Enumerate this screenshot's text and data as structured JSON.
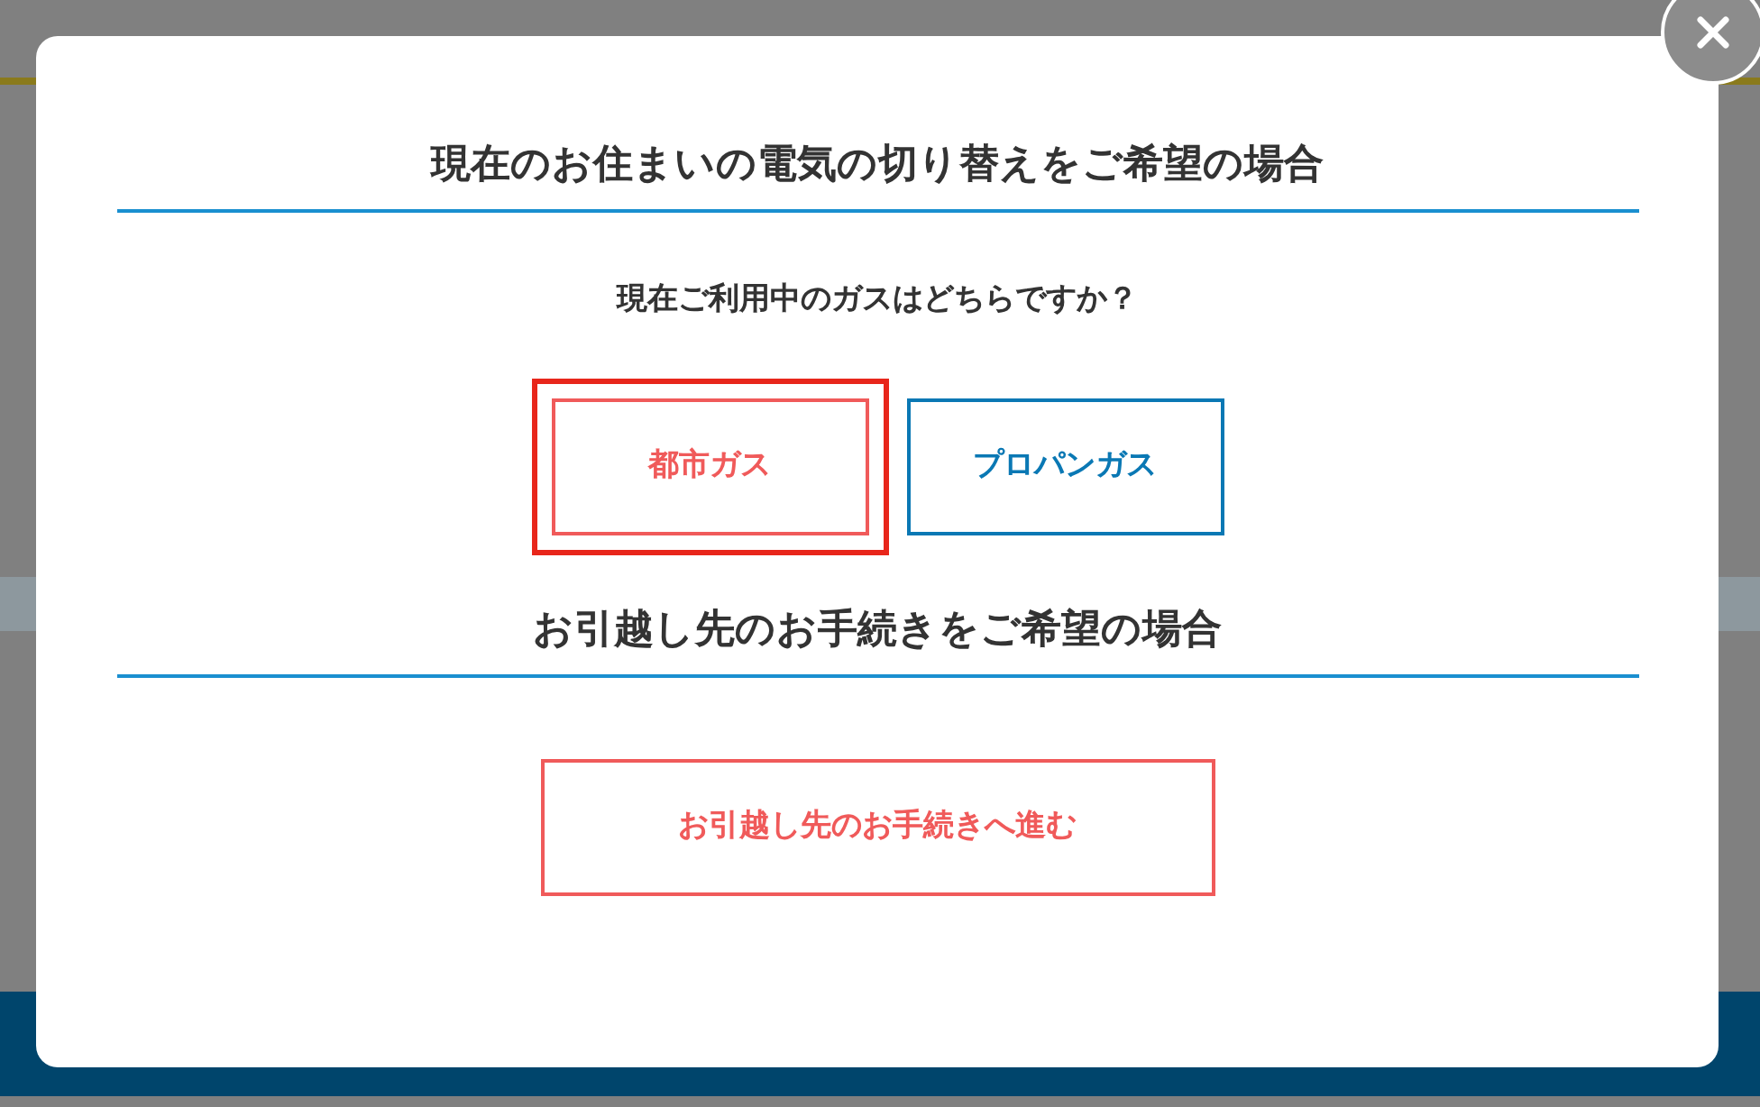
{
  "sections": [
    {
      "heading": "現在のお住まいの電気の切り替えをご希望の場合",
      "question": "現在ご利用中のガスはどちらですか？",
      "options": [
        {
          "label": "都市ガス",
          "color": "#f05a5a",
          "highlighted": true,
          "wide": false
        },
        {
          "label": "プロパンガス",
          "color": "#0a78b4",
          "highlighted": false,
          "wide": false
        }
      ]
    },
    {
      "heading": "お引越し先のお手続きをご希望の場合",
      "options": [
        {
          "label": "お引越し先のお手続きへ進む",
          "color": "#f05a5a",
          "highlighted": false,
          "wide": true
        }
      ]
    }
  ]
}
